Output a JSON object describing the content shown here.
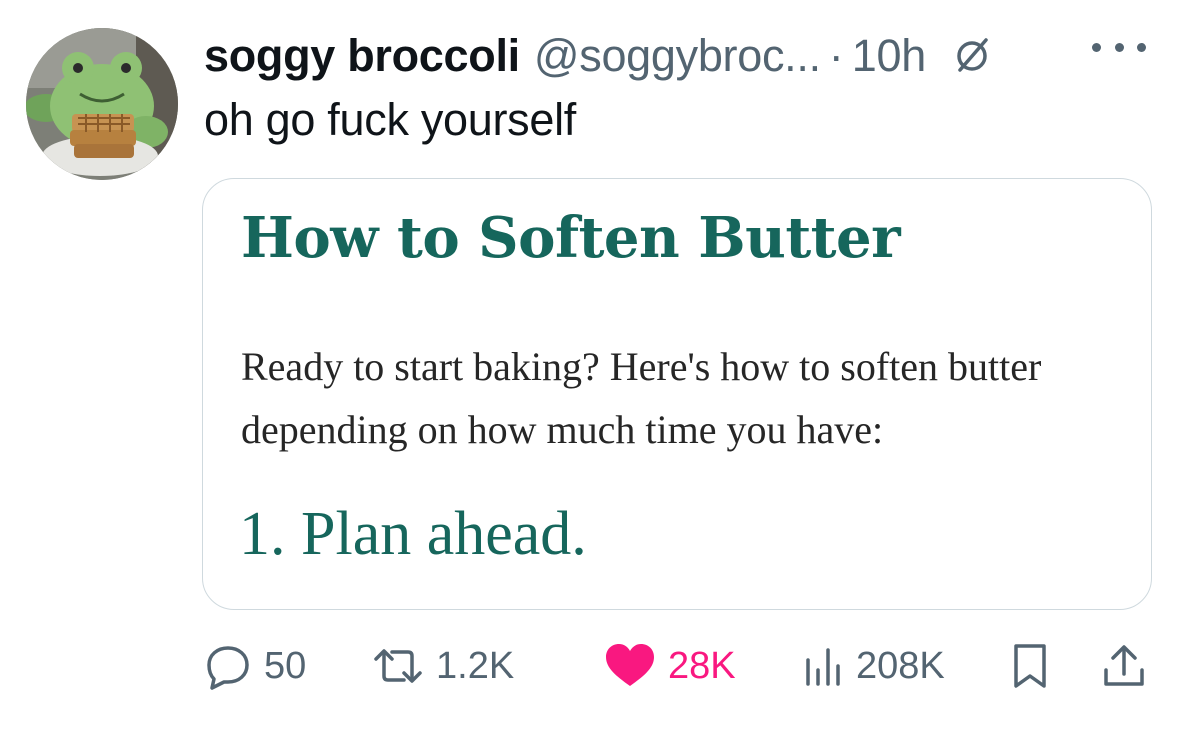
{
  "tweet": {
    "author": {
      "display_name": "soggy broccoli",
      "handle": "@soggybroc...",
      "avatar_icon": "frog-plush-avatar"
    },
    "separator": "·",
    "time": "10h",
    "text": "oh go fuck yourself",
    "card": {
      "title": "How to Soften Butter",
      "body": "Ready to start baking? Here's how to soften butter depending on how much time you have:",
      "step": "1. Plan ahead."
    },
    "actions": {
      "replies": "50",
      "retweets": "1.2K",
      "likes": "28K",
      "views": "208K"
    }
  },
  "colors": {
    "accent_teal": "#16665c",
    "like_pink": "#f91880",
    "muted": "#536471"
  }
}
